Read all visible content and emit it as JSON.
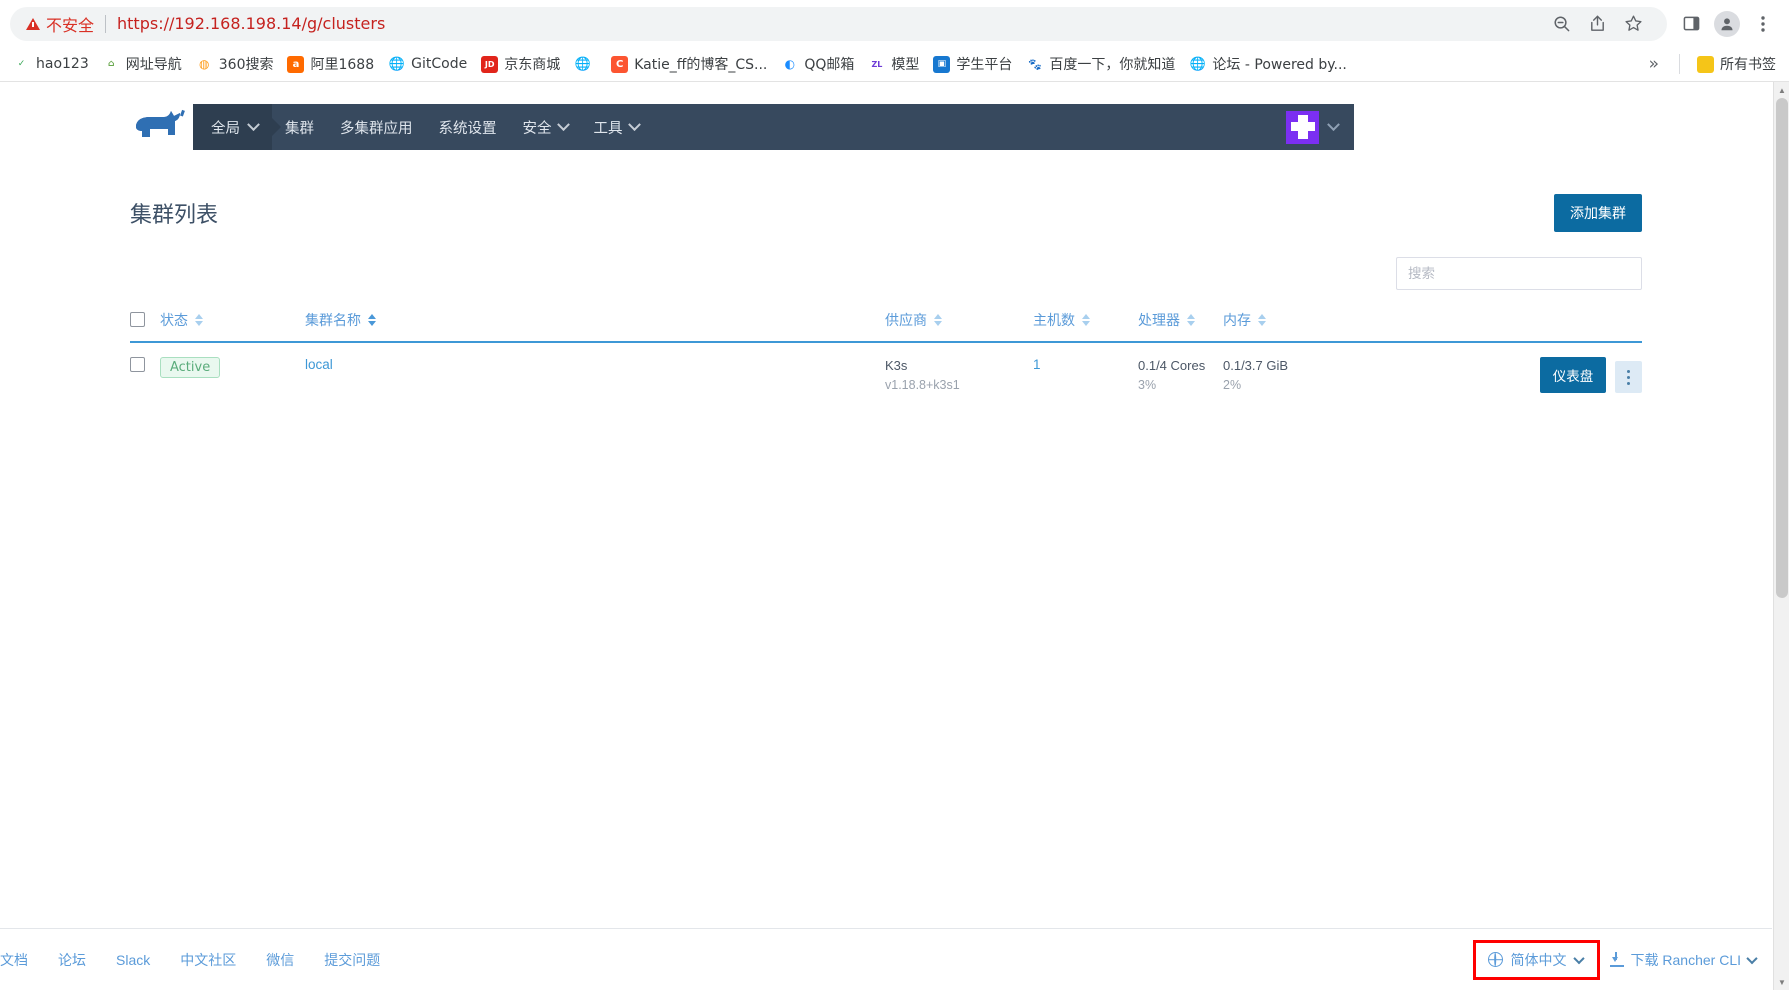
{
  "browser": {
    "security_label": "不安全",
    "url": "https://192.168.198.14/g/clusters",
    "omnibox_icons": [
      "zoom-out-icon",
      "share-icon",
      "star-icon"
    ],
    "toolbar_icons": [
      "side-panel-icon",
      "profile-avatar-icon",
      "chrome-menu-icon"
    ],
    "bookmarks": [
      {
        "label": "hao123",
        "icon": "hao123-favicon",
        "color": "#3aa757",
        "glyph": "h"
      },
      {
        "label": "网址导航",
        "icon": "hao-nav-favicon",
        "color": "#7bb661",
        "glyph": "2"
      },
      {
        "label": "360搜索",
        "icon": "360-search-favicon",
        "color": "#ff9a14",
        "glyph": "O"
      },
      {
        "label": "阿里1688",
        "icon": "alibaba-favicon",
        "color": "#ff6a00",
        "glyph": "a"
      },
      {
        "label": "GitCode",
        "icon": "globe-favicon",
        "color": "#6b7280",
        "glyph": "⊕"
      },
      {
        "label": "京东商城",
        "icon": "jd-favicon",
        "color": "#e1251b",
        "glyph": "JD"
      },
      {
        "label": "",
        "icon": "globe-favicon",
        "color": "#6b7280",
        "glyph": "⊕"
      },
      {
        "label": "Katie_ff的博客_CS...",
        "icon": "csdn-favicon",
        "color": "#fc5531",
        "glyph": "C"
      },
      {
        "label": "QQ邮箱",
        "icon": "qq-mail-favicon",
        "color": "#1a8cff",
        "glyph": "Q"
      },
      {
        "label": "模型",
        "icon": "zl-favicon",
        "color": "#ffffff",
        "glyph": "ZL"
      },
      {
        "label": "学生平台",
        "icon": "student-platform-favicon",
        "color": "#1778d0",
        "glyph": "▣"
      },
      {
        "label": "百度一下，你就知道",
        "icon": "baidu-favicon",
        "color": "#2932e1",
        "glyph": "熊"
      },
      {
        "label": "论坛 - Powered by...",
        "icon": "globe-favicon",
        "color": "#6b7280",
        "glyph": "⊕"
      }
    ],
    "overflow_label": "»",
    "all_bookmarks_label": "所有书签",
    "all_bookmarks_icon": "folder-icon"
  },
  "nav": {
    "logo": "rancher-cow-logo",
    "scope": "全局",
    "items": [
      {
        "label": "集群",
        "has_dropdown": false
      },
      {
        "label": "多集群应用",
        "has_dropdown": false
      },
      {
        "label": "系统设置",
        "has_dropdown": false
      },
      {
        "label": "安全",
        "has_dropdown": true
      },
      {
        "label": "工具",
        "has_dropdown": true
      }
    ],
    "user_avatar": "user-avatar-purple",
    "background": "#37495e"
  },
  "page": {
    "title": "集群列表",
    "add_cluster_label": "添加集群",
    "search_placeholder": "搜索",
    "search_value": ""
  },
  "table": {
    "columns": [
      {
        "label": "状态",
        "sortable": true,
        "active": false
      },
      {
        "label": "集群名称",
        "sortable": true,
        "active": true
      },
      {
        "label": "供应商",
        "sortable": true,
        "active": false
      },
      {
        "label": "主机数",
        "sortable": true,
        "active": false
      },
      {
        "label": "处理器",
        "sortable": true,
        "active": false
      },
      {
        "label": "内存",
        "sortable": true,
        "active": false
      }
    ],
    "rows": [
      {
        "selected": false,
        "state": "Active",
        "name": "local",
        "provider": "K3s",
        "provider_version": "v1.18.8+k3s1",
        "nodes": "1",
        "cpu": "0.1/4 Cores",
        "cpu_pct": "3%",
        "memory": "0.1/3.7 GiB",
        "memory_pct": "2%",
        "dashboard_label": "仪表盘",
        "menu_icon": "kebab-menu-icon"
      }
    ]
  },
  "footer": {
    "links": [
      "文档",
      "论坛",
      "Slack",
      "中文社区",
      "微信",
      "提交问题"
    ],
    "language_label": "简体中文",
    "language_icon": "globe-icon",
    "cli_label": "下载 Rancher CLI",
    "cli_icon": "download-icon",
    "highlight_color": "#ff0000"
  },
  "colors": {
    "primary_button": "#0c6ba1",
    "nav_background": "#37495e",
    "link_blue": "#3d98d6",
    "badge_green": "#5aac7b"
  }
}
